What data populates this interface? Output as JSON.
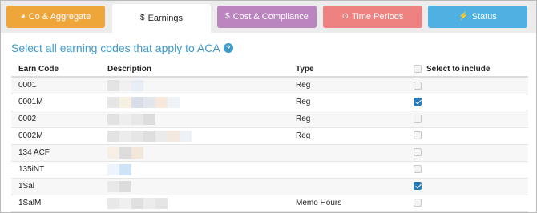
{
  "tabs": [
    {
      "icon": "pie-chart-icon",
      "glyph": "◕",
      "label": "Co & Aggregate"
    },
    {
      "icon": "dollar-icon",
      "glyph": "$",
      "label": "Earnings"
    },
    {
      "icon": "dollar-icon",
      "glyph": "$",
      "label": "Cost & Compliance"
    },
    {
      "icon": "clock-icon",
      "glyph": "⊙",
      "label": "Time Periods"
    },
    {
      "icon": "bolt-icon",
      "glyph": "⚡",
      "label": "Status"
    }
  ],
  "active_tab": "Earnings",
  "heading": {
    "text": "Select all earning codes that apply to ACA",
    "help_icon": "?"
  },
  "table": {
    "columns": [
      "Earn Code",
      "Description",
      "Type",
      "Select to include"
    ],
    "header_checked": false,
    "rows": [
      {
        "code": "0001",
        "type": "Reg",
        "checked": false
      },
      {
        "code": "0001M",
        "type": "Reg",
        "checked": true
      },
      {
        "code": "0002",
        "type": "Reg",
        "checked": false
      },
      {
        "code": "0002M",
        "type": "Reg",
        "checked": false
      },
      {
        "code": "134 ACF",
        "type": "",
        "checked": false
      },
      {
        "code": "135iNT",
        "type": "",
        "checked": false
      },
      {
        "code": "1Sal",
        "type": "",
        "checked": true
      },
      {
        "code": "1SalM",
        "type": "Memo Hours",
        "checked": false
      }
    ]
  },
  "colors": {
    "co": "#eea63a",
    "cost": "#bb86c0",
    "time": "#ee8281",
    "status": "#4fb0e2",
    "accent": "#3d9bcd",
    "check": "#2a7bb5"
  }
}
